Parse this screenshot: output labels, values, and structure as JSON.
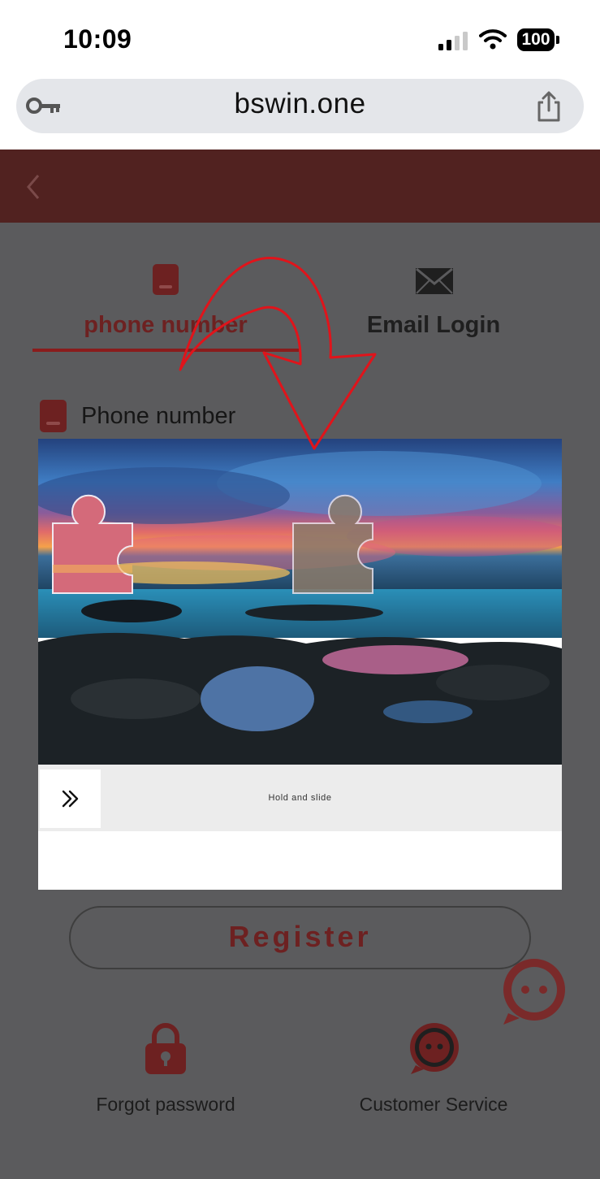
{
  "status_bar": {
    "time": "10:09",
    "battery_level": "100",
    "signal_icon": "cellular-signal-icon",
    "wifi_icon": "wifi-icon"
  },
  "browser": {
    "url": "bswin.one",
    "left_icon": "key-icon",
    "right_icon": "share-icon"
  },
  "header": {
    "back_icon": "chevron-left-icon"
  },
  "tabs": [
    {
      "label": "phone number",
      "icon": "phone-icon",
      "active": true
    },
    {
      "label": "Email Login",
      "icon": "envelope-icon",
      "active": false
    }
  ],
  "form": {
    "phone_label": "Phone number"
  },
  "captcha": {
    "instruction": "Hold and slide",
    "handle_icon": "double-chevron-right-icon"
  },
  "register_button": {
    "label": "Register"
  },
  "footer": {
    "forgot_password": "Forgot password",
    "customer_service": "Customer Service"
  },
  "colors": {
    "accent": "#6d2121",
    "header": "#512220",
    "overlay": "#5b5b5d",
    "annotation": "#e0141b"
  }
}
